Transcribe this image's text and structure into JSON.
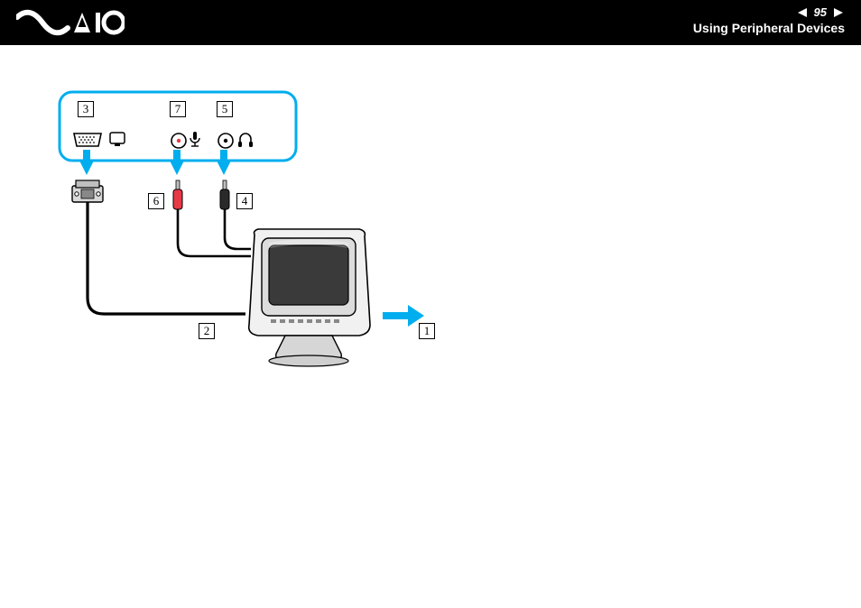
{
  "header": {
    "page_number": "95",
    "section_title": "Using Peripheral Devices",
    "logo_alt": "VAIO"
  },
  "callouts": {
    "c1": "1",
    "c2": "2",
    "c3": "3",
    "c4": "4",
    "c5": "5",
    "c6": "6",
    "c7": "7"
  },
  "colors": {
    "accent": "#00AEEF",
    "black": "#000000"
  }
}
